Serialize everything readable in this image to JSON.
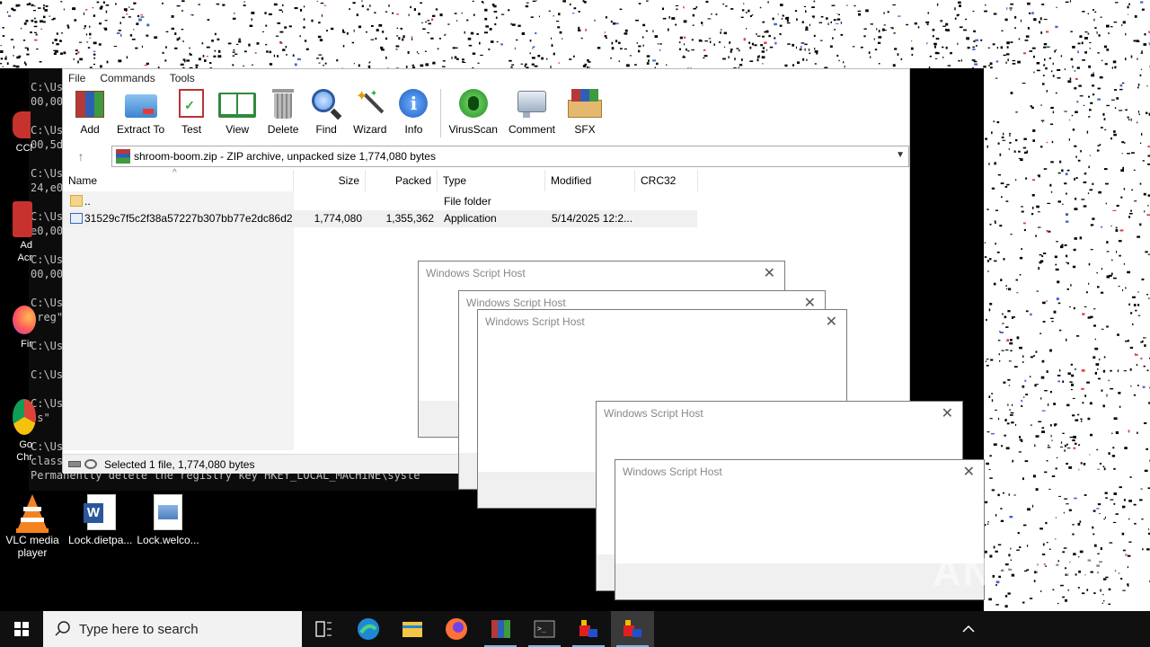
{
  "desktop": {
    "icons": [
      {
        "name": "ccleaner",
        "label": "CCl"
      },
      {
        "name": "adobe-acrobat",
        "label": "Ad\nAcr"
      },
      {
        "name": "firefox",
        "label": "Fir"
      },
      {
        "name": "chrome",
        "label": "Go\nChr"
      },
      {
        "name": "vlc",
        "label": "VLC media\nplayer"
      },
      {
        "name": "word-doc",
        "label": "Lock.dietpa..."
      },
      {
        "name": "image-file",
        "label": "Lock.welco..."
      }
    ]
  },
  "cmd": {
    "lines": [
      "C:\\Us",
      "00,00",
      "C:\\Us",
      "00,5d",
      "C:\\Us",
      "24,e0",
      "C:\\Us",
      "e0,00",
      "C:\\Us",
      "00,00",
      "C:\\Us",
      ".reg\"",
      "C:\\Us",
      "C:\\Us",
      "C:\\Us",
      "ss\"",
      "C:\\Us",
      "class",
      "Permanently delete the registry key HKEY_LOCAL_MACHINE\\syste"
    ]
  },
  "winrar": {
    "menu": [
      "File",
      "Commands",
      "Tools"
    ],
    "toolbar": [
      {
        "id": "add",
        "label": "Add"
      },
      {
        "id": "extract",
        "label": "Extract To"
      },
      {
        "id": "test",
        "label": "Test"
      },
      {
        "id": "view",
        "label": "View"
      },
      {
        "id": "delete",
        "label": "Delete"
      },
      {
        "id": "find",
        "label": "Find"
      },
      {
        "id": "wizard",
        "label": "Wizard"
      },
      {
        "id": "info",
        "label": "Info"
      },
      {
        "id": "virusscan",
        "label": "VirusScan"
      },
      {
        "id": "comment",
        "label": "Comment"
      },
      {
        "id": "sfx",
        "label": "SFX"
      }
    ],
    "address": "shroom-boom.zip - ZIP archive, unpacked size 1,774,080 bytes",
    "columns": [
      "Name",
      "Size",
      "Packed",
      "Type",
      "Modified",
      "CRC32"
    ],
    "rows": [
      {
        "name": "..",
        "size": "",
        "packed": "",
        "type": "File folder",
        "modified": ""
      },
      {
        "name": "31529c7f5c2f38a57227b307bb77e2dc86d28...",
        "size": "1,774,080",
        "packed": "1,355,362",
        "type": "Application",
        "modified": "5/14/2025 12:2..."
      }
    ],
    "status": "Selected 1 file, 1,774,080 bytes"
  },
  "dialogs": {
    "title": "Windows Script Host"
  },
  "taskbar": {
    "search_placeholder": "Type here to search"
  },
  "watermark": "ANY RUN"
}
